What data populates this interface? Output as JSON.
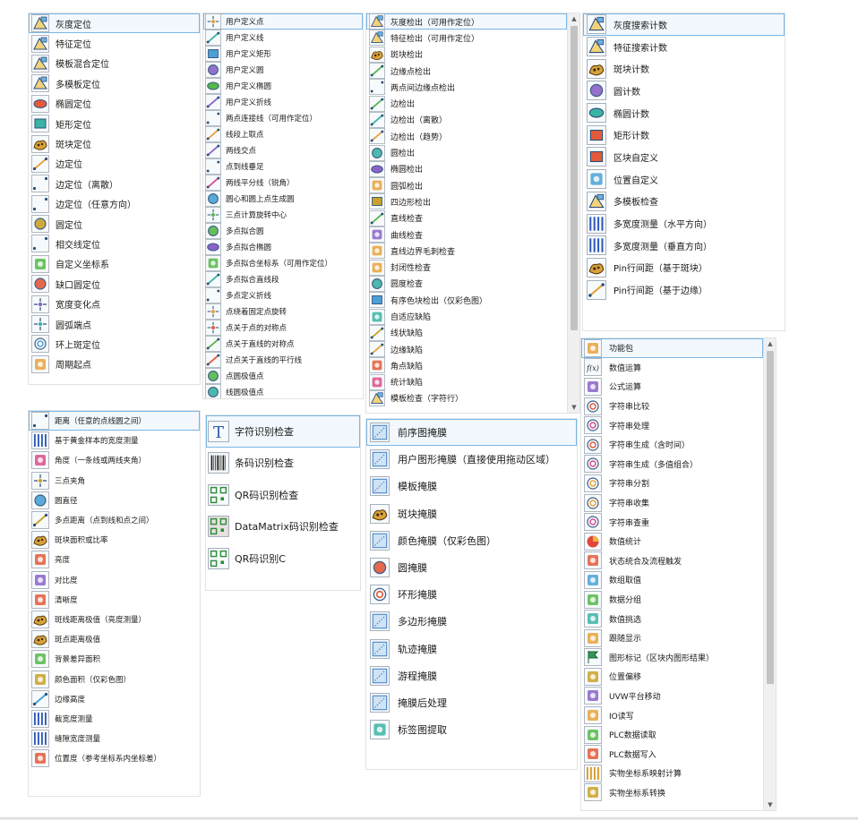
{
  "panels": {
    "locate": {
      "selected": 0,
      "items": [
        {
          "label": "灰度定位",
          "icon": "grayscale-locate-icon"
        },
        {
          "label": "特征定位",
          "icon": "feature-locate-icon"
        },
        {
          "label": "模板混合定位",
          "icon": "template-mix-locate-icon"
        },
        {
          "label": "多模板定位",
          "icon": "multi-template-locate-icon"
        },
        {
          "label": "椭圆定位",
          "icon": "ellipse-locate-icon"
        },
        {
          "label": "矩形定位",
          "icon": "rectangle-locate-icon"
        },
        {
          "label": "斑块定位",
          "icon": "blob-locate-icon"
        },
        {
          "label": "边定位",
          "icon": "edge-locate-icon"
        },
        {
          "label": "边定位（离散）",
          "icon": "edge-locate-discrete-icon"
        },
        {
          "label": "边定位（任意方向）",
          "icon": "edge-locate-any-direction-icon"
        },
        {
          "label": "圆定位",
          "icon": "circle-locate-icon"
        },
        {
          "label": "相交线定位",
          "icon": "intersecting-lines-locate-icon"
        },
        {
          "label": "自定义坐标系",
          "icon": "custom-coordinate-icon"
        },
        {
          "label": "缺口圆定位",
          "icon": "notched-circle-locate-icon"
        },
        {
          "label": "宽度变化点",
          "icon": "width-change-point-icon"
        },
        {
          "label": "圆弧端点",
          "icon": "arc-endpoint-icon"
        },
        {
          "label": "环上斑定位",
          "icon": "ring-blob-locate-icon"
        },
        {
          "label": "周期起点",
          "icon": "period-start-icon"
        }
      ]
    },
    "geometry": {
      "selected": 0,
      "items": [
        {
          "label": "用户定义点",
          "icon": "user-point-icon"
        },
        {
          "label": "用户定义线",
          "icon": "user-line-icon"
        },
        {
          "label": "用户定义矩形",
          "icon": "user-rectangle-icon"
        },
        {
          "label": "用户定义圆",
          "icon": "user-circle-icon"
        },
        {
          "label": "用户定义椭圆",
          "icon": "user-ellipse-icon"
        },
        {
          "label": "用户定义折线",
          "icon": "user-polyline-icon"
        },
        {
          "label": "两点连接线（可用作定位）",
          "icon": "two-point-line-icon"
        },
        {
          "label": "线段上取点",
          "icon": "point-on-segment-icon"
        },
        {
          "label": "两线交点",
          "icon": "line-intersection-icon"
        },
        {
          "label": "点到线垂足",
          "icon": "perpendicular-foot-icon"
        },
        {
          "label": "两线平分线（锐角）",
          "icon": "angle-bisector-icon"
        },
        {
          "label": "圆心和圆上点生成圆",
          "icon": "center-point-circle-icon"
        },
        {
          "label": "三点计算旋转中心",
          "icon": "rotation-center-icon"
        },
        {
          "label": "多点拟合圆",
          "icon": "fit-circle-icon"
        },
        {
          "label": "多点拟合椭圆",
          "icon": "fit-ellipse-icon"
        },
        {
          "label": "多点拟合坐标系（可用作定位）",
          "icon": "fit-coordinate-icon"
        },
        {
          "label": "多点拟合直线段",
          "icon": "fit-line-icon"
        },
        {
          "label": "多点定义折线",
          "icon": "multi-point-polyline-icon"
        },
        {
          "label": "点绕着固定点旋转",
          "icon": "rotate-point-icon"
        },
        {
          "label": "点关于点的对称点",
          "icon": "point-symmetry-icon"
        },
        {
          "label": "点关于直线的对称点",
          "icon": "line-symmetry-icon"
        },
        {
          "label": "过点关于直线的平行线",
          "icon": "parallel-line-icon"
        },
        {
          "label": "点圆极值点",
          "icon": "point-circle-extreme-icon"
        },
        {
          "label": "线圆极值点",
          "icon": "line-circle-extreme-icon"
        }
      ]
    },
    "detect": {
      "selected": 0,
      "items": [
        {
          "label": "灰度检出（可用作定位）",
          "icon": "grayscale-detect-icon"
        },
        {
          "label": "特征检出（可用作定位）",
          "icon": "feature-detect-icon"
        },
        {
          "label": "斑块检出",
          "icon": "blob-detect-icon"
        },
        {
          "label": "边缘点检出",
          "icon": "edge-point-detect-icon"
        },
        {
          "label": "两点间边缘点检出",
          "icon": "two-point-edge-detect-icon"
        },
        {
          "label": "边检出",
          "icon": "edge-detect-icon"
        },
        {
          "label": "边检出（离散）",
          "icon": "edge-detect-discrete-icon"
        },
        {
          "label": "边检出（趋势）",
          "icon": "edge-detect-trend-icon"
        },
        {
          "label": "圆检出",
          "icon": "circle-detect-icon"
        },
        {
          "label": "椭圆检出",
          "icon": "ellipse-detect-icon"
        },
        {
          "label": "圆弧检出",
          "icon": "arc-detect-icon"
        },
        {
          "label": "四边形检出",
          "icon": "quadrilateral-detect-icon"
        },
        {
          "label": "直线检查",
          "icon": "line-check-icon"
        },
        {
          "label": "曲线检查",
          "icon": "curve-check-icon"
        },
        {
          "label": "直线边界毛刺检查",
          "icon": "burr-check-icon"
        },
        {
          "label": "封闭性检查",
          "icon": "closure-check-icon"
        },
        {
          "label": "圆度检查",
          "icon": "roundness-check-icon"
        },
        {
          "label": "有序色块检出（仅彩色图）",
          "icon": "color-block-detect-icon"
        },
        {
          "label": "自适应缺陷",
          "icon": "adaptive-defect-icon"
        },
        {
          "label": "线状缺陷",
          "icon": "line-defect-icon"
        },
        {
          "label": "边缘缺陷",
          "icon": "edge-defect-icon"
        },
        {
          "label": "角点缺陷",
          "icon": "corner-defect-icon"
        },
        {
          "label": "统计缺陷",
          "icon": "statistical-defect-icon"
        },
        {
          "label": "模板检查（字符行）",
          "icon": "template-check-chars-icon"
        }
      ]
    },
    "count": {
      "selected": 0,
      "items": [
        {
          "label": "灰度搜索计数",
          "icon": "grayscale-count-icon"
        },
        {
          "label": "特征搜索计数",
          "icon": "feature-count-icon"
        },
        {
          "label": "斑块计数",
          "icon": "blob-count-icon"
        },
        {
          "label": "圆计数",
          "icon": "circle-count-icon"
        },
        {
          "label": "椭圆计数",
          "icon": "ellipse-count-icon"
        },
        {
          "label": "矩形计数",
          "icon": "rectangle-count-icon"
        },
        {
          "label": "区块自定义",
          "icon": "block-custom-icon"
        },
        {
          "label": "位置自定义",
          "icon": "position-custom-icon"
        },
        {
          "label": "多模板检查",
          "icon": "multi-template-check-icon"
        },
        {
          "label": "多宽度测量（水平方向）",
          "icon": "width-horizontal-icon"
        },
        {
          "label": "多宽度测量（垂直方向）",
          "icon": "width-vertical-icon"
        },
        {
          "label": "Pin行间距（基于斑块）",
          "icon": "pin-pitch-blob-icon"
        },
        {
          "label": "Pin行间距（基于边缘）",
          "icon": "pin-pitch-edge-icon"
        }
      ]
    },
    "measure": {
      "selected": 0,
      "items": [
        {
          "label": "距离（任意的点线圆之间）",
          "icon": "distance-icon"
        },
        {
          "label": "基于黄金样本的宽度测量",
          "icon": "golden-width-icon"
        },
        {
          "label": "角度（一条线或两线夹角）",
          "icon": "angle-icon"
        },
        {
          "label": "三点夹角",
          "icon": "three-point-angle-icon"
        },
        {
          "label": "圆直径",
          "icon": "diameter-icon"
        },
        {
          "label": "多点距离（点到线和点之间）",
          "icon": "multi-distance-icon"
        },
        {
          "label": "斑块面积或比率",
          "icon": "blob-area-icon"
        },
        {
          "label": "亮度",
          "icon": "brightness-icon"
        },
        {
          "label": "对比度",
          "icon": "contrast-icon"
        },
        {
          "label": "清晰度",
          "icon": "sharpness-icon"
        },
        {
          "label": "斑线距离极值（亮度测量）",
          "icon": "blob-line-distance-icon"
        },
        {
          "label": "斑点距离极值",
          "icon": "blob-point-distance-icon"
        },
        {
          "label": "背景差异面积",
          "icon": "background-diff-icon"
        },
        {
          "label": "颜色面积（仅彩色图）",
          "icon": "color-area-icon"
        },
        {
          "label": "边缘高度",
          "icon": "edge-height-icon"
        },
        {
          "label": "截宽度测量",
          "icon": "cut-width-icon"
        },
        {
          "label": "缝隙宽度测量",
          "icon": "gap-width-icon"
        },
        {
          "label": "位置度（参考坐标系内坐标差）",
          "icon": "position-tolerance-icon"
        }
      ]
    },
    "code": {
      "selected": 0,
      "items": [
        {
          "label": "字符识别检查",
          "icon": "ocr-icon"
        },
        {
          "label": "条码识别检查",
          "icon": "barcode-icon"
        },
        {
          "label": "QR码识别检查",
          "icon": "qr-check-icon"
        },
        {
          "label": "DataMatrix码识别检查",
          "icon": "datamatrix-icon"
        },
        {
          "label": "QR码识别C",
          "icon": "qr-c-icon"
        }
      ]
    },
    "mask": {
      "selected": 0,
      "items": [
        {
          "label": "前序图掩膜",
          "icon": "previous-mask-icon"
        },
        {
          "label": "用户图形掩膜（直接使用拖动区域）",
          "icon": "user-shape-mask-icon"
        },
        {
          "label": "模板掩膜",
          "icon": "template-mask-icon"
        },
        {
          "label": "斑块掩膜",
          "icon": "blob-mask-icon"
        },
        {
          "label": "颜色掩膜（仅彩色图）",
          "icon": "color-mask-icon"
        },
        {
          "label": "圆掩膜",
          "icon": "circle-mask-icon"
        },
        {
          "label": "环形掩膜",
          "icon": "ring-mask-icon"
        },
        {
          "label": "多边形掩膜",
          "icon": "polygon-mask-icon"
        },
        {
          "label": "轨迹掩膜",
          "icon": "track-mask-icon"
        },
        {
          "label": "游程掩膜",
          "icon": "run-length-mask-icon"
        },
        {
          "label": "掩膜后处理",
          "icon": "mask-postprocess-icon"
        },
        {
          "label": "标签图提取",
          "icon": "label-extract-icon"
        }
      ]
    },
    "tools": {
      "selected": 0,
      "items": [
        {
          "label": "功能包",
          "icon": "package-icon"
        },
        {
          "label": "数值运算",
          "icon": "function-icon"
        },
        {
          "label": "公式运算",
          "icon": "calculator-icon"
        },
        {
          "label": "字符串比较",
          "icon": "string-compare-icon"
        },
        {
          "label": "字符串处理",
          "icon": "string-process-icon"
        },
        {
          "label": "字符串生成（含时间）",
          "icon": "string-time-icon"
        },
        {
          "label": "字符串生成（多值组合）",
          "icon": "string-combine-icon"
        },
        {
          "label": "字符串分割",
          "icon": "string-split-icon"
        },
        {
          "label": "字符串收集",
          "icon": "string-collect-icon"
        },
        {
          "label": "字符串查重",
          "icon": "string-dedupe-icon"
        },
        {
          "label": "数值统计",
          "icon": "pie-chart-icon"
        },
        {
          "label": "状态统合及流程触发",
          "icon": "flow-trigger-icon"
        },
        {
          "label": "数组取值",
          "icon": "array-value-icon"
        },
        {
          "label": "数据分组",
          "icon": "data-group-icon"
        },
        {
          "label": "数值挑选",
          "icon": "value-select-icon"
        },
        {
          "label": "跟随显示",
          "icon": "follow-display-icon"
        },
        {
          "label": "图形标记（区块内图形结果）",
          "icon": "flag-icon"
        },
        {
          "label": "位置偏移",
          "icon": "position-offset-icon"
        },
        {
          "label": "UVW平台移动",
          "icon": "uvw-platform-icon"
        },
        {
          "label": "IO读写",
          "icon": "io-icon"
        },
        {
          "label": "PLC数据读取",
          "icon": "plc-read-icon"
        },
        {
          "label": "PLC数据写入",
          "icon": "plc-write-icon"
        },
        {
          "label": "实物坐标系映射计算",
          "icon": "coordinate-mapping-icon"
        },
        {
          "label": "实物坐标系转换",
          "icon": "coordinate-transform-icon"
        }
      ]
    }
  }
}
